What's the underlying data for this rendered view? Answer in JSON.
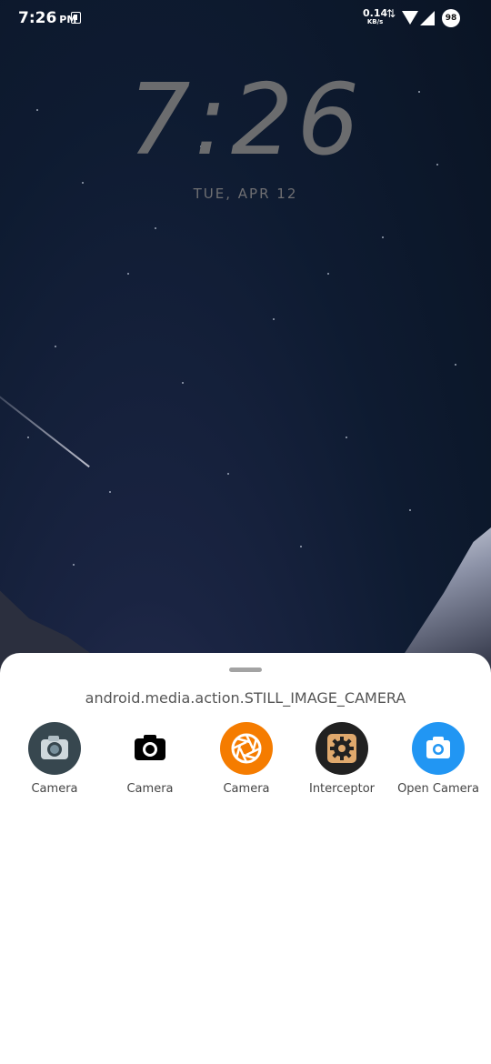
{
  "status_bar": {
    "time": "7:26",
    "ampm": "PM",
    "net_speed": "0.14",
    "net_unit": "KB/s",
    "battery": "98"
  },
  "lockscreen": {
    "clock": "7:26",
    "date": "TUE, APR 12"
  },
  "chooser": {
    "title": "android.media.action.STILL_IMAGE_CAMERA",
    "apps": [
      {
        "label": "Camera",
        "icon": "camera-grey-icon",
        "color": "#37474f"
      },
      {
        "label": "Camera",
        "icon": "camera-black-icon",
        "color": "#000000"
      },
      {
        "label": "Camera",
        "icon": "aperture-orange-icon",
        "color": "#f57c00"
      },
      {
        "label": "Interceptor",
        "icon": "gear-icon",
        "color": "#212121"
      },
      {
        "label": "Open Camera",
        "icon": "camera-blue-icon",
        "color": "#2196f3"
      }
    ]
  }
}
